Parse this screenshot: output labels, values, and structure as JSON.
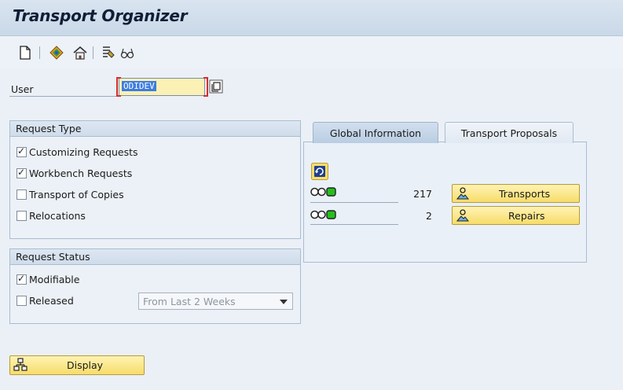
{
  "window": {
    "title": "Transport Organizer"
  },
  "toolbar": {
    "icons": [
      "new-document-icon",
      "display-change-icon",
      "transport-icon",
      "filter-icon",
      "glasses-icon"
    ]
  },
  "user_field": {
    "label": "User",
    "value": "ODIDEV"
  },
  "request_type": {
    "title": "Request Type",
    "items": [
      {
        "label": "Customizing Requests",
        "checked": true
      },
      {
        "label": "Workbench Requests",
        "checked": true
      },
      {
        "label": "Transport of Copies",
        "checked": false
      },
      {
        "label": "Relocations",
        "checked": false
      }
    ]
  },
  "request_status": {
    "title": "Request Status",
    "items": [
      {
        "label": "Modifiable",
        "checked": true
      },
      {
        "label": "Released",
        "checked": false
      }
    ],
    "period_select": {
      "value": "From Last 2 Weeks"
    }
  },
  "tabs": [
    {
      "label": "Global Information",
      "active": true
    },
    {
      "label": "Transport Proposals",
      "active": false
    }
  ],
  "global_info": {
    "rows": [
      {
        "count": "217",
        "button": "Transports"
      },
      {
        "count": "2",
        "button": "Repairs"
      }
    ]
  },
  "display_button": {
    "label": "Display"
  },
  "colors": {
    "accent_yellow": "#f7dd6a",
    "input_yellow": "#fbf1b5",
    "selection_blue": "#3d7ce0",
    "required_red": "#d62d2d",
    "light_green": "#22c11c"
  }
}
